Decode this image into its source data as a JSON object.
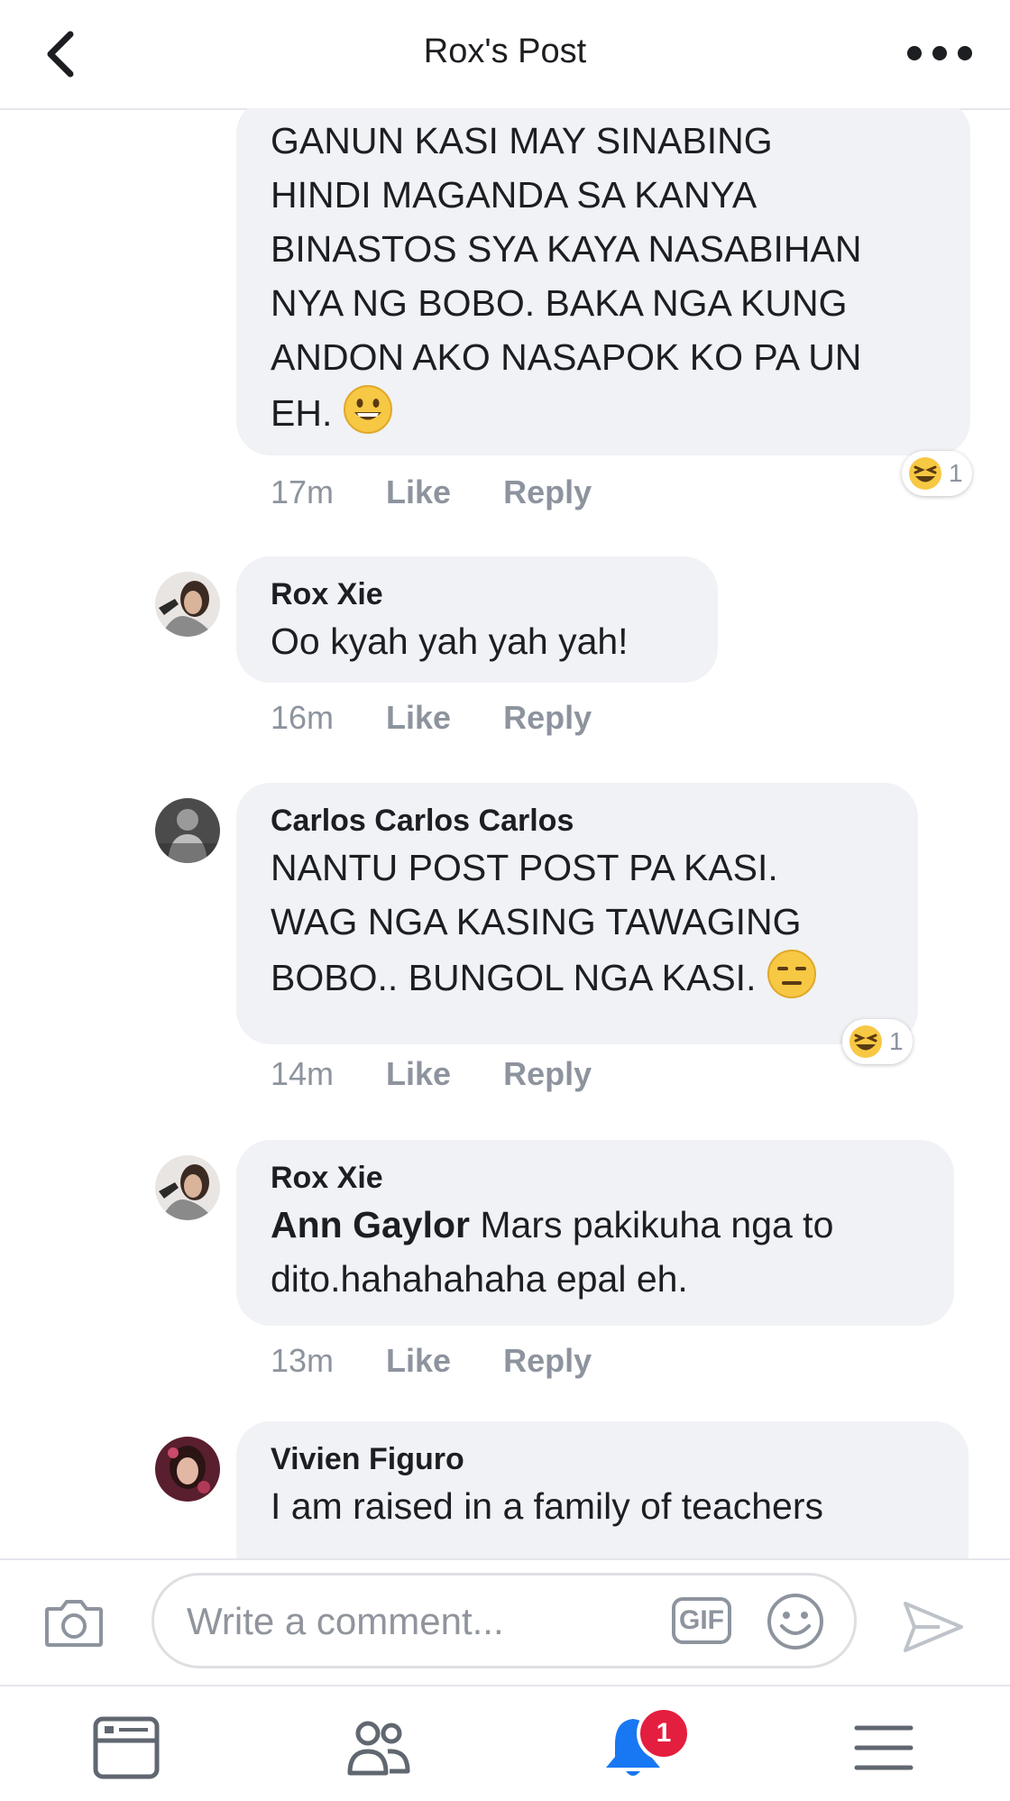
{
  "header": {
    "title": "Rox's Post"
  },
  "comments": [
    {
      "lines": [
        "GANUN KASI MAY SINABING",
        "HINDI MAGANDA SA KANYA",
        "BINASTOS SYA KAYA NASABIHAN",
        "NYA NG BOBO. BAKA NGA KUNG",
        "ANDON AKO NASAPOK KO PA UN",
        "EH."
      ],
      "emoji": "grinning-face",
      "time": "17m",
      "like_label": "Like",
      "reply_label": "Reply",
      "reaction": {
        "icon": "laughing-face",
        "count": "1"
      }
    },
    {
      "author": "Rox Xie",
      "lines": [
        "Oo kyah yah yah yah!"
      ],
      "time": "16m",
      "like_label": "Like",
      "reply_label": "Reply"
    },
    {
      "author": "Carlos Carlos Carlos",
      "lines": [
        "NANTU POST POST PA KASI.",
        "WAG NGA KASING TAWAGING",
        "BOBO.. BUNGOL NGA KASI."
      ],
      "emoji": "expressionless-face",
      "time": "14m",
      "like_label": "Like",
      "reply_label": "Reply",
      "reaction": {
        "icon": "laughing-face",
        "count": "1"
      }
    },
    {
      "author": "Rox Xie",
      "mention": "Ann Gaylor",
      "text_after_mention": " Mars pakikuha nga to",
      "lines": [
        "dito.hahahahaha epal eh."
      ],
      "time": "13m",
      "like_label": "Like",
      "reply_label": "Reply"
    },
    {
      "author": "Vivien Figuro",
      "lines": [
        "I am raised in a family of teachers"
      ]
    }
  ],
  "composer": {
    "placeholder": "Write a comment...",
    "gif_label": "GIF"
  },
  "tabbar": {
    "notification_count": "1"
  },
  "colors": {
    "bubble": "#f0f2f5",
    "meta_text": "#8d949e",
    "badge": "#e41e3f",
    "accent": "#1877f2"
  }
}
